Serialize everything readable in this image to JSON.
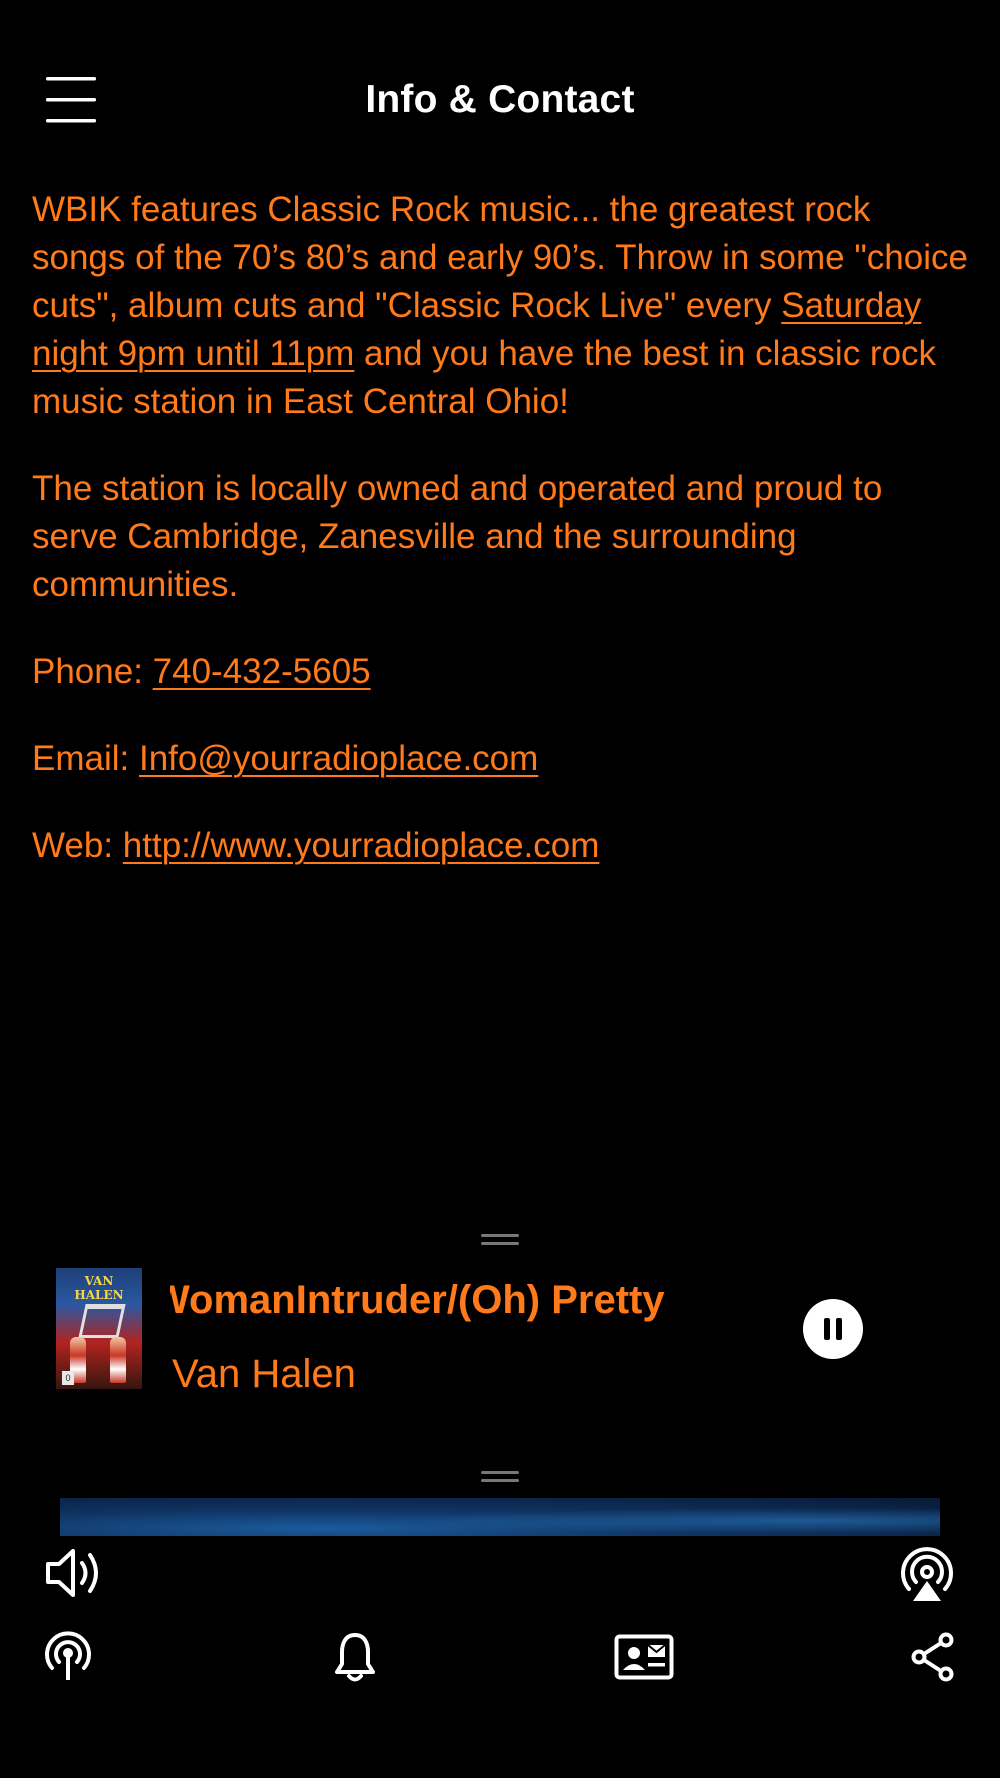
{
  "header": {
    "title": "Info & Contact",
    "menu_icon": "hamburger-menu-icon"
  },
  "content": {
    "p1_before_link": "WBIK features Classic Rock music... the greatest rock songs of the 70’s 80’s and early 90’s. Throw in some \"choice cuts\", album cuts and \"Classic Rock Live\" every ",
    "p1_link": "Saturday night 9pm until 11pm",
    "p1_after_link": " and you have the best in classic rock music station in East Central Ohio!",
    "p2": "The station is locally owned and operated and proud to serve Cambridge, Zanesville and the surrounding communities.",
    "phone_label": "Phone: ",
    "phone_value": "740-432-5605",
    "email_label": "Email: ",
    "email_value": "Info@yourradioplace.com",
    "web_label": "Web: ",
    "web_value": "http://www.yourradioplace.com"
  },
  "player": {
    "track_title": "WomanIntruder/(Oh) Pretty",
    "artist": "Van Halen",
    "album_art_text": "VAN HALEN",
    "album_art_badge": "0",
    "state": "playing"
  },
  "colors": {
    "background": "#000000",
    "accent": "#ff7a1a",
    "title": "#ffffff"
  },
  "toolbar": {
    "volume_icon": "volume-icon",
    "airplay_icon": "airplay-icon"
  },
  "tab_bar": {
    "items": [
      {
        "icon": "broadcast-icon"
      },
      {
        "icon": "bell-icon"
      },
      {
        "icon": "contact-card-icon"
      },
      {
        "icon": "share-icon"
      }
    ]
  }
}
